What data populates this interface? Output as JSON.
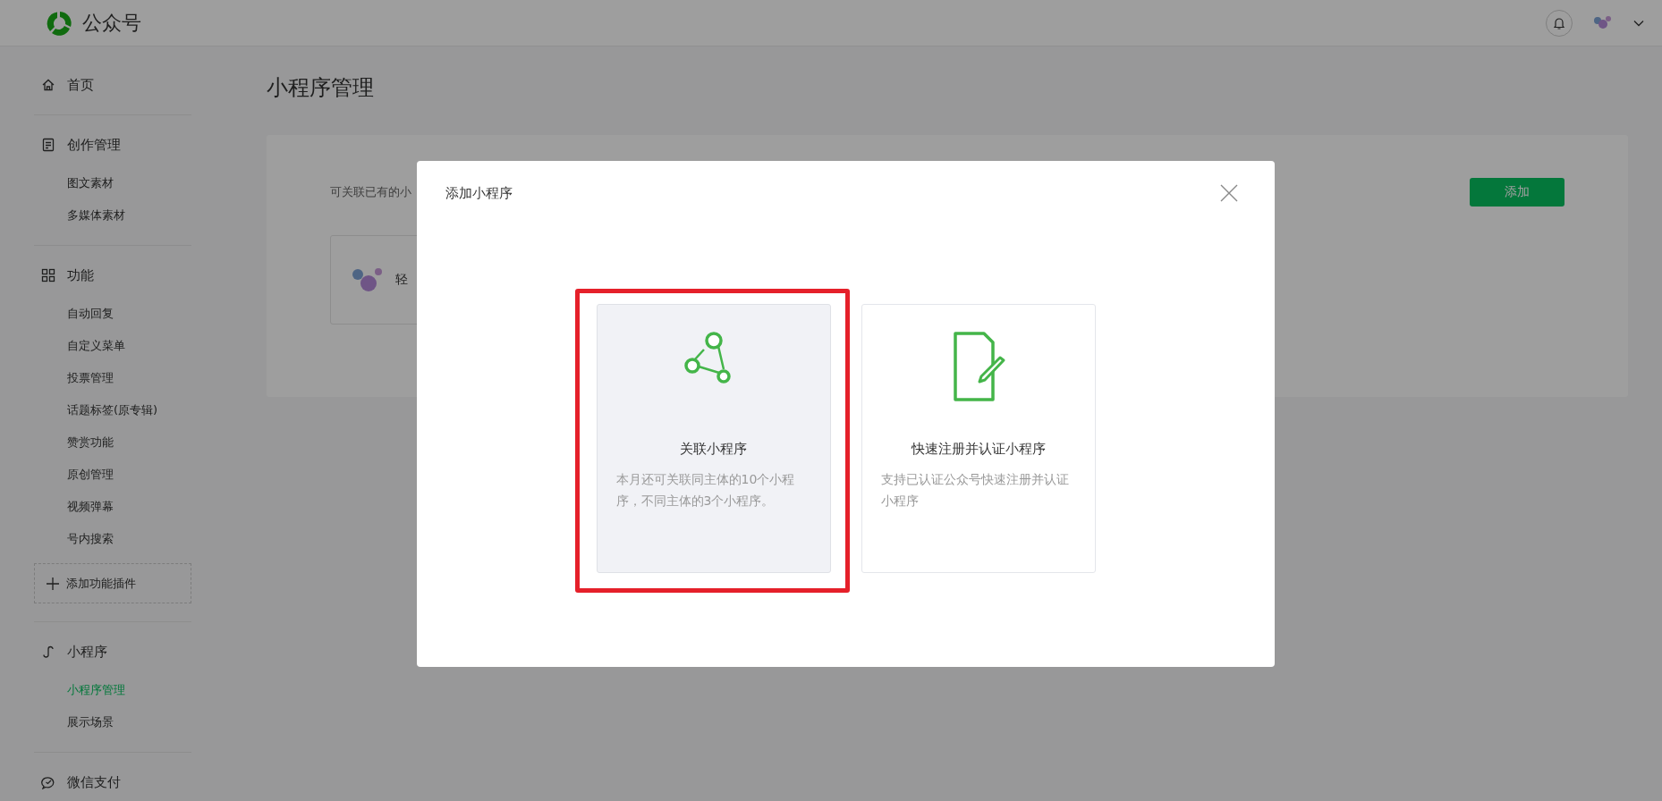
{
  "header": {
    "title": "公众号"
  },
  "sidebar": {
    "groups": [
      {
        "kind": "section",
        "label": "首页"
      },
      {
        "kind": "section",
        "label": "创作管理",
        "items": [
          {
            "label": "图文素材",
            "selected": false
          },
          {
            "label": "多媒体素材",
            "selected": false
          }
        ]
      },
      {
        "kind": "section",
        "label": "功能",
        "items": [
          {
            "label": "自动回复",
            "selected": false
          },
          {
            "label": "自定义菜单",
            "selected": false
          },
          {
            "label": "投票管理",
            "selected": false
          },
          {
            "label": "话题标签(原专辑)",
            "selected": false
          },
          {
            "label": "赞赏功能",
            "selected": false
          },
          {
            "label": "原创管理",
            "selected": false
          },
          {
            "label": "视频弹幕",
            "selected": false
          },
          {
            "label": "号内搜索",
            "selected": false
          }
        ]
      },
      {
        "kind": "plugin-button",
        "label": "添加功能插件"
      },
      {
        "kind": "section",
        "label": "小程序",
        "items": [
          {
            "label": "小程序管理",
            "selected": true
          },
          {
            "label": "展示场景",
            "selected": false
          }
        ]
      },
      {
        "kind": "section",
        "label": "微信支付"
      }
    ]
  },
  "main": {
    "page_title": "小程序管理",
    "panel": {
      "description": "可关联已有的小",
      "add_button": "添加",
      "mini_program": {
        "name": "轻"
      }
    }
  },
  "modal": {
    "title": "添加小程序",
    "options": [
      {
        "title": "关联小程序",
        "description": "本月还可关联同主体的10个小程序，不同主体的3个小程序。",
        "selected": true,
        "highlighted": true
      },
      {
        "title": "快速注册并认证小程序",
        "description": "支持已认证公众号快速注册并认证小程序",
        "selected": false,
        "highlighted": false
      }
    ]
  }
}
